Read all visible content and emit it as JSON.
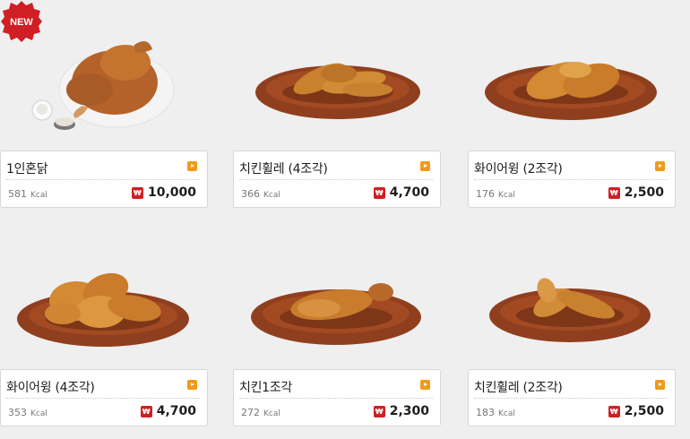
{
  "currency_icon": "won-icon",
  "more_icon": "play-arrow-icon",
  "accent_color": "#f09a1a",
  "badge_color": "#d01f24",
  "new_badge_label": "NEW",
  "products": [
    {
      "name": "1인혼닭",
      "kcal": "581",
      "unit": "Kcal",
      "price": "10,000",
      "is_new": true
    },
    {
      "name": "치킨휠레 (4조각)",
      "kcal": "366",
      "unit": "Kcal",
      "price": "4,700",
      "is_new": false
    },
    {
      "name": "화이어윙 (2조각)",
      "kcal": "176",
      "unit": "Kcal",
      "price": "2,500",
      "is_new": false
    },
    {
      "name": "화이어윙 (4조각)",
      "kcal": "353",
      "unit": "Kcal",
      "price": "4,700",
      "is_new": false
    },
    {
      "name": "치킨1조각",
      "kcal": "272",
      "unit": "Kcal",
      "price": "2,300",
      "is_new": false
    },
    {
      "name": "치킨휠레 (2조각)",
      "kcal": "183",
      "unit": "Kcal",
      "price": "2,500",
      "is_new": false
    }
  ]
}
